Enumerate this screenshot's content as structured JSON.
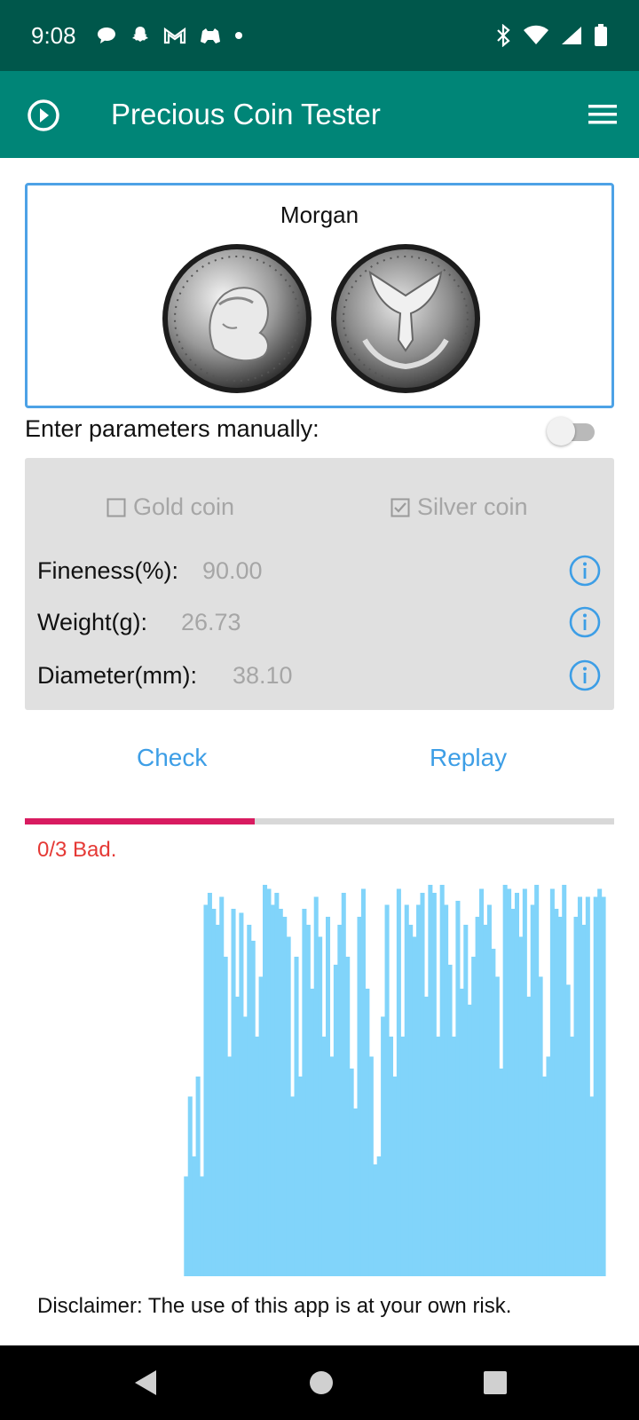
{
  "status_bar": {
    "time": "9:08",
    "left_icons": [
      "chat-bubble-icon",
      "snapchat-icon",
      "gmail-icon",
      "game-icon",
      "dot-icon"
    ],
    "right_icons": [
      "bluetooth-icon",
      "wifi-icon",
      "signal-icon",
      "battery-icon"
    ]
  },
  "app_bar": {
    "title": "Precious Coin Tester",
    "left_icon": "play-circle-icon",
    "right_icon": "menu-icon"
  },
  "coin": {
    "name": "Morgan"
  },
  "manual": {
    "label": "Enter parameters manually:",
    "enabled": false
  },
  "params": {
    "gold_label": "Gold coin",
    "gold_checked": false,
    "silver_label": "Silver coin",
    "silver_checked": true,
    "fineness_label": "Fineness(%):",
    "fineness_value": "90.00",
    "weight_label": "Weight(g):",
    "weight_value": "26.73",
    "diameter_label": "Diameter(mm):",
    "diameter_value": "38.10"
  },
  "buttons": {
    "check": "Check",
    "replay": "Replay"
  },
  "progress": {
    "fraction": 0.39,
    "color": "#d81b60"
  },
  "result_text": "0/3 Bad.",
  "chart_data": {
    "type": "area",
    "color": "#81d4fa",
    "ylim": [
      0,
      1
    ],
    "x_start_fraction": 0.27,
    "values": [
      0.25,
      0.45,
      0.3,
      0.5,
      0.25,
      0.93,
      0.96,
      0.92,
      0.88,
      0.95,
      0.8,
      0.55,
      0.92,
      0.7,
      0.91,
      0.65,
      0.88,
      0.84,
      0.6,
      0.75,
      0.98,
      0.97,
      0.93,
      0.96,
      0.92,
      0.9,
      0.85,
      0.45,
      0.8,
      0.5,
      0.92,
      0.88,
      0.72,
      0.95,
      0.85,
      0.6,
      0.9,
      0.55,
      0.78,
      0.88,
      0.96,
      0.8,
      0.52,
      0.42,
      0.9,
      0.97,
      0.72,
      0.55,
      0.28,
      0.3,
      0.65,
      0.93,
      0.6,
      0.5,
      0.97,
      0.6,
      0.93,
      0.88,
      0.85,
      0.93,
      0.96,
      0.7,
      0.98,
      0.96,
      0.6,
      0.98,
      0.93,
      0.78,
      0.6,
      0.94,
      0.72,
      0.88,
      0.68,
      0.8,
      0.9,
      0.97,
      0.88,
      0.93,
      0.82,
      0.75,
      0.52,
      0.98,
      0.97,
      0.92,
      0.96,
      0.85,
      0.97,
      0.7,
      0.93,
      0.98,
      0.75,
      0.5,
      0.55,
      0.97,
      0.92,
      0.9,
      0.98,
      0.73,
      0.6,
      0.9,
      0.95,
      0.88,
      0.95,
      0.45,
      0.95,
      0.97,
      0.95
    ]
  },
  "disclaimer": "Disclaimer: The use of this app is at your own risk.",
  "nav": {
    "back_icon": "back-triangle-icon",
    "home_icon": "home-circle-icon",
    "recent_icon": "recent-square-icon"
  }
}
